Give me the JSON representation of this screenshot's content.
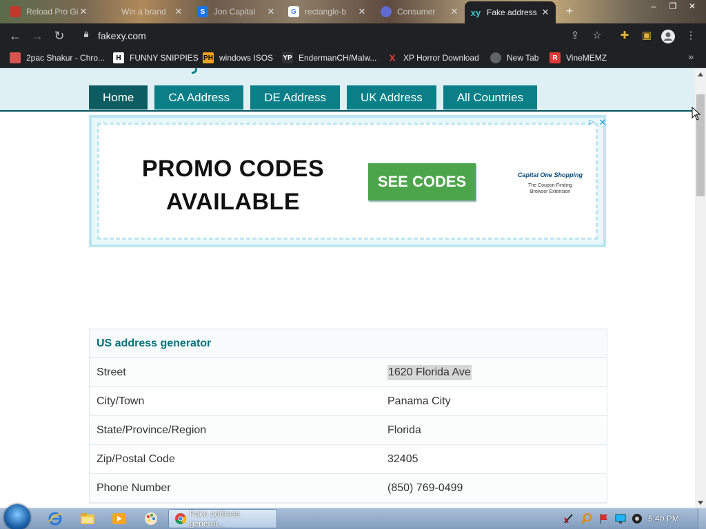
{
  "browser": {
    "tabs": [
      {
        "title": "Reload Pro Gi",
        "icon": "red-splash-favicon"
      },
      {
        "title": "Win a brand",
        "icon": "apple-icon"
      },
      {
        "title": "Jon Capital",
        "icon": "s-blue-favicon"
      },
      {
        "title": "rectangle-b",
        "icon": "google-g-icon"
      },
      {
        "title": "Consumer",
        "icon": "swirl-favicon"
      },
      {
        "title": "Fake address",
        "icon": "xy-favicon",
        "active": true
      }
    ],
    "url": "fakexy.com",
    "bookmarks": [
      {
        "label": "2pac Shakur - Chro...",
        "icon": "bookmark-shop-icon"
      },
      {
        "label": "FUNNY SNIPPIES",
        "icon": "h-icon"
      },
      {
        "label": "windows ISOS",
        "icon": "ph-icon"
      },
      {
        "label": "EndermanCH/Malw...",
        "icon": "yp-icon"
      },
      {
        "label": "XP Horror Download",
        "icon": "red-x-icon"
      },
      {
        "label": "New Tab",
        "icon": "globe-icon"
      },
      {
        "label": "VineMEMZ",
        "icon": "r-icon"
      }
    ]
  },
  "site": {
    "nav": [
      "Home",
      "CA Address",
      "DE Address",
      "UK Address",
      "All Countries"
    ],
    "active_nav": "Home",
    "ad": {
      "headline_line1": "PROMO CODES",
      "headline_line2": "AVAILABLE",
      "cta": "SEE CODES",
      "brand": "Capital One Shopping",
      "tagline_line1": "The Coupon-Finding",
      "tagline_line2": "Browser Extension"
    },
    "generator": {
      "title": "US address generator",
      "rows": [
        {
          "label": "Street",
          "value": "1620 Florida Ave"
        },
        {
          "label": "City/Town",
          "value": "Panama City"
        },
        {
          "label": "State/Province/Region",
          "value": "Florida"
        },
        {
          "label": "Zip/Postal Code",
          "value": "32405"
        },
        {
          "label": "Phone Number",
          "value": "(850) 769-0499"
        }
      ]
    }
  },
  "taskbar": {
    "task_title": "Fake address generat...",
    "clock": "5:40 PM"
  },
  "colors": {
    "nav_bg": "#0a7f87",
    "nav_active": "#0b5d62",
    "title_teal": "#00707a",
    "cta_green": "#4ca54a"
  }
}
